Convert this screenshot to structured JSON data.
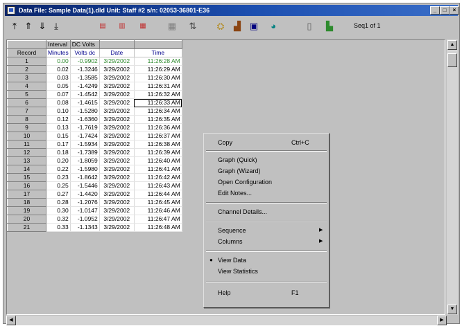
{
  "window": {
    "title": "Data   File: Sample Data(1).dld   Unit: Staff #2   s/n: 02053-36801-E36",
    "controls": {
      "minimize": "_",
      "maximize": "□",
      "close": "×"
    }
  },
  "toolbar": {
    "sequence_label": "Seq1 of 1"
  },
  "grid": {
    "header_row1": {
      "interval": "Interval",
      "volts": "DC Volts"
    },
    "header_row2": {
      "record": "Record",
      "minutes": "Minutes",
      "volts": "Volts dc",
      "date": "Date",
      "time": "Time"
    },
    "rows": [
      {
        "record": "1",
        "minutes": "0.00",
        "volts": "-0.9902",
        "date": "3/29/2002",
        "time": "11:26:28 AM"
      },
      {
        "record": "2",
        "minutes": "0.02",
        "volts": "-1.3246",
        "date": "3/29/2002",
        "time": "11:26:29 AM"
      },
      {
        "record": "3",
        "minutes": "0.03",
        "volts": "-1.3585",
        "date": "3/29/2002",
        "time": "11:26:30 AM"
      },
      {
        "record": "4",
        "minutes": "0.05",
        "volts": "-1.4249",
        "date": "3/29/2002",
        "time": "11:26:31 AM"
      },
      {
        "record": "5",
        "minutes": "0.07",
        "volts": "-1.4542",
        "date": "3/29/2002",
        "time": "11:26:32 AM"
      },
      {
        "record": "6",
        "minutes": "0.08",
        "volts": "-1.4615",
        "date": "3/29/2002",
        "time": "11:26:33 AM"
      },
      {
        "record": "7",
        "minutes": "0.10",
        "volts": "-1.5280",
        "date": "3/29/2002",
        "time": "11:26:34 AM"
      },
      {
        "record": "8",
        "minutes": "0.12",
        "volts": "-1.6360",
        "date": "3/29/2002",
        "time": "11:26:35 AM"
      },
      {
        "record": "9",
        "minutes": "0.13",
        "volts": "-1.7619",
        "date": "3/29/2002",
        "time": "11:26:36 AM"
      },
      {
        "record": "10",
        "minutes": "0.15",
        "volts": "-1.7424",
        "date": "3/29/2002",
        "time": "11:26:37 AM"
      },
      {
        "record": "11",
        "minutes": "0.17",
        "volts": "-1.5934",
        "date": "3/29/2002",
        "time": "11:26:38 AM"
      },
      {
        "record": "12",
        "minutes": "0.18",
        "volts": "-1.7389",
        "date": "3/29/2002",
        "time": "11:26:39 AM"
      },
      {
        "record": "13",
        "minutes": "0.20",
        "volts": "-1.8059",
        "date": "3/29/2002",
        "time": "11:26:40 AM"
      },
      {
        "record": "14",
        "minutes": "0.22",
        "volts": "-1.5980",
        "date": "3/29/2002",
        "time": "11:26:41 AM"
      },
      {
        "record": "15",
        "minutes": "0.23",
        "volts": "-1.8642",
        "date": "3/29/2002",
        "time": "11:26:42 AM"
      },
      {
        "record": "16",
        "minutes": "0.25",
        "volts": "-1.5446",
        "date": "3/29/2002",
        "time": "11:26:43 AM"
      },
      {
        "record": "17",
        "minutes": "0.27",
        "volts": "-1.4420",
        "date": "3/29/2002",
        "time": "11:26:44 AM"
      },
      {
        "record": "18",
        "minutes": "0.28",
        "volts": "-1.2076",
        "date": "3/29/2002",
        "time": "11:26:45 AM"
      },
      {
        "record": "19",
        "minutes": "0.30",
        "volts": "-1.0147",
        "date": "3/29/2002",
        "time": "11:26:46 AM"
      },
      {
        "record": "20",
        "minutes": "0.32",
        "volts": "-1.0952",
        "date": "3/29/2002",
        "time": "11:26:47 AM"
      },
      {
        "record": "21",
        "minutes": "0.33",
        "volts": "-1.1343",
        "date": "3/29/2002",
        "time": "11:26:48 AM"
      }
    ]
  },
  "context_menu": {
    "copy": "Copy",
    "copy_shortcut": "Ctrl+C",
    "graph_quick": "Graph (Quick)",
    "graph_wizard": "Graph (Wizard)",
    "open_config": "Open Configuration",
    "edit_notes": "Edit Notes...",
    "channel_details": "Channel Details...",
    "sequence": "Sequence",
    "columns": "Columns",
    "view_data": "View Data",
    "view_statistics": "View Statistics",
    "help": "Help",
    "help_shortcut": "F1",
    "checked_item": "View Data"
  },
  "colors": {
    "title_bar": "#0a246a",
    "first_row_text": "#2e8b2e",
    "header_text": "#00008b"
  }
}
